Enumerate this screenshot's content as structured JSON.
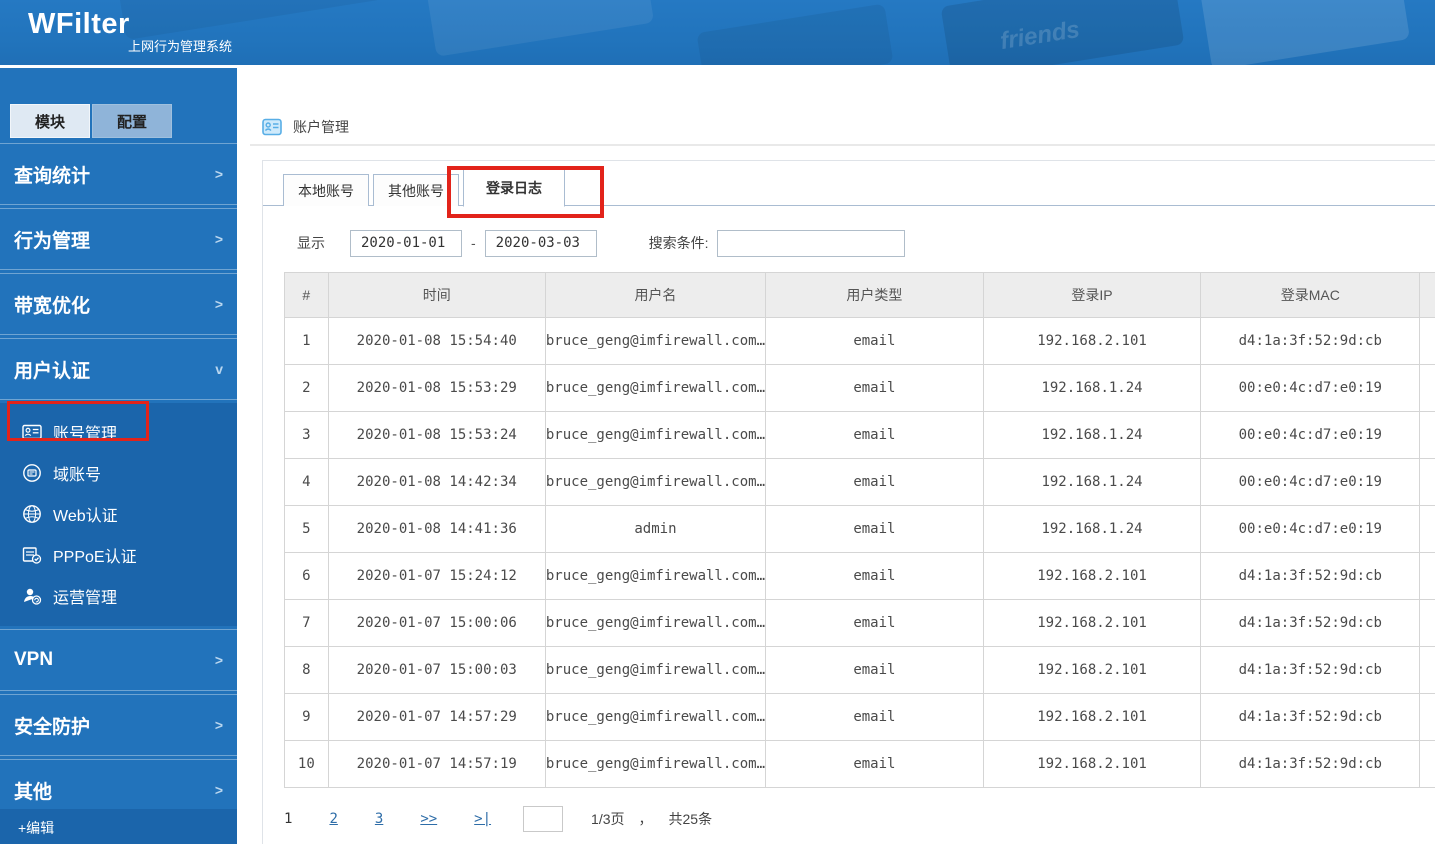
{
  "header": {
    "logo": "WFilter",
    "subtitle": "上网行为管理系统",
    "keycap_label": "friends"
  },
  "sidebar": {
    "tabs": [
      {
        "label": "模块",
        "active": true
      },
      {
        "label": "配置",
        "active": false
      }
    ],
    "menu_top": [
      {
        "label": "查询统计",
        "chevron": ">"
      },
      {
        "label": "行为管理",
        "chevron": ">"
      },
      {
        "label": "带宽优化",
        "chevron": ">"
      },
      {
        "label": "用户认证",
        "chevron": "v",
        "active": true
      }
    ],
    "submenu": [
      {
        "label": "账号管理",
        "icon": "id-card-icon",
        "highlight": true
      },
      {
        "label": "域账号",
        "icon": "domain-account-icon"
      },
      {
        "label": "Web认证",
        "icon": "globe-icon"
      },
      {
        "label": "PPPoE认证",
        "icon": "document-check-icon"
      },
      {
        "label": "运营管理",
        "icon": "operator-icon"
      }
    ],
    "menu_bottom": [
      {
        "label": "VPN",
        "chevron": ">"
      },
      {
        "label": "安全防护",
        "chevron": ">"
      },
      {
        "label": "其他",
        "chevron": ">"
      }
    ],
    "edit_label": "+编辑"
  },
  "breadcrumb": {
    "title": "账户管理"
  },
  "content_tabs": [
    {
      "label": "本地账号",
      "active": false
    },
    {
      "label": "其他账号",
      "active": false
    },
    {
      "label": "登录日志",
      "active": true
    }
  ],
  "filters": {
    "show_label": "显示",
    "date_from": "2020-01-01",
    "date_separator": "-",
    "date_to": "2020-03-03",
    "search_label": "搜索条件:",
    "search_value": ""
  },
  "table": {
    "columns": [
      "#",
      "时间",
      "用户名",
      "用户类型",
      "登录IP",
      "登录MAC",
      ""
    ],
    "rows": [
      [
        "1",
        "2020-01-08 15:54:40",
        "bruce_geng@imfirewall.com…",
        "email",
        "192.168.2.101",
        "d4:1a:3f:52:9d:cb",
        ""
      ],
      [
        "2",
        "2020-01-08 15:53:29",
        "bruce_geng@imfirewall.com…",
        "email",
        "192.168.1.24",
        "00:e0:4c:d7:e0:19",
        ""
      ],
      [
        "3",
        "2020-01-08 15:53:24",
        "bruce_geng@imfirewall.com…",
        "email",
        "192.168.1.24",
        "00:e0:4c:d7:e0:19",
        ""
      ],
      [
        "4",
        "2020-01-08 14:42:34",
        "bruce_geng@imfirewall.com…",
        "email",
        "192.168.1.24",
        "00:e0:4c:d7:e0:19",
        ""
      ],
      [
        "5",
        "2020-01-08 14:41:36",
        "admin",
        "email",
        "192.168.1.24",
        "00:e0:4c:d7:e0:19",
        ""
      ],
      [
        "6",
        "2020-01-07 15:24:12",
        "bruce_geng@imfirewall.com…",
        "email",
        "192.168.2.101",
        "d4:1a:3f:52:9d:cb",
        ""
      ],
      [
        "7",
        "2020-01-07 15:00:06",
        "bruce_geng@imfirewall.com…",
        "email",
        "192.168.2.101",
        "d4:1a:3f:52:9d:cb",
        ""
      ],
      [
        "8",
        "2020-01-07 15:00:03",
        "bruce_geng@imfirewall.com…",
        "email",
        "192.168.2.101",
        "d4:1a:3f:52:9d:cb",
        ""
      ],
      [
        "9",
        "2020-01-07 14:57:29",
        "bruce_geng@imfirewall.com…",
        "email",
        "192.168.2.101",
        "d4:1a:3f:52:9d:cb",
        ""
      ],
      [
        "10",
        "2020-01-07 14:57:19",
        "bruce_geng@imfirewall.com…",
        "email",
        "192.168.2.101",
        "d4:1a:3f:52:9d:cb",
        ""
      ]
    ]
  },
  "pagination": {
    "current": "1",
    "pages": [
      "2",
      "3"
    ],
    "next_label": ">>",
    "last_label": ">|",
    "input_value": "",
    "page_info": "1/3页",
    "comma": "，",
    "total_info": "共25条"
  },
  "colors": {
    "banner_blue": "#2173bb",
    "sidebar_blue": "#2273bb",
    "submenu_blue": "#1b65ab",
    "active_tab_bar": "#6fa3d8",
    "annotation_red": "#e2231a",
    "link_blue": "#2e6da8",
    "table_header_bg": "#ededed"
  }
}
